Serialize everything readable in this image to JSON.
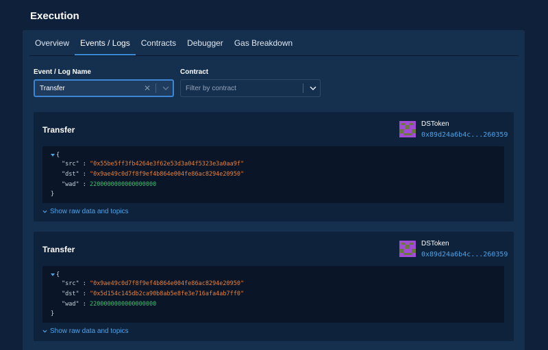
{
  "page_title": "Execution",
  "tabs": [
    "Overview",
    "Events / Logs",
    "Contracts",
    "Debugger",
    "Gas Breakdown"
  ],
  "filters": {
    "event_label": "Event / Log Name",
    "event_value": "Transfer",
    "contract_label": "Contract",
    "contract_placeholder": "Filter by contract"
  },
  "events": [
    {
      "name": "Transfer",
      "contract_name": "DSToken",
      "contract_address": "0x89d24a6b4c...260359",
      "open_brace": "{",
      "close_brace": "}",
      "fields": [
        {
          "key": "\"src\"",
          "sep": " : ",
          "value": "\"0x55be5ff3fb4264e3f62e53d3a04f5323e3a0aa9f\"",
          "kind": "string"
        },
        {
          "key": "\"dst\"",
          "sep": " : ",
          "value": "\"0x9ae49c0d7f8f9ef4b864e004fe86ac8294e20950\"",
          "kind": "string"
        },
        {
          "key": "\"wad\"",
          "sep": " : ",
          "value": "2200000000000000000",
          "kind": "number"
        }
      ],
      "show_raw": "Show raw data and topics"
    },
    {
      "name": "Transfer",
      "contract_name": "DSToken",
      "contract_address": "0x89d24a6b4c...260359",
      "open_brace": "{",
      "close_brace": "}",
      "fields": [
        {
          "key": "\"src\"",
          "sep": " : ",
          "value": "\"0x9ae49c0d7f8f9ef4b864e004fe86ac8294e20950\"",
          "kind": "string"
        },
        {
          "key": "\"dst\"",
          "sep": " : ",
          "value": "\"0x5d154c145db2ca90b8ab5e8fe3e716afa4ab7ff0\"",
          "kind": "string"
        },
        {
          "key": "\"wad\"",
          "sep": " : ",
          "value": "2200000000000000000",
          "kind": "number"
        }
      ],
      "show_raw": "Show raw data and topics"
    }
  ],
  "colors": {
    "background": "#0f213a",
    "panel": "#15304f",
    "accent": "#3b8bd6",
    "link": "#4da3e8",
    "json_string": "#e8823a",
    "json_number": "#3fbf6e",
    "avatar_purple": "#a24bd6",
    "avatar_olive": "#6b7a3a"
  }
}
